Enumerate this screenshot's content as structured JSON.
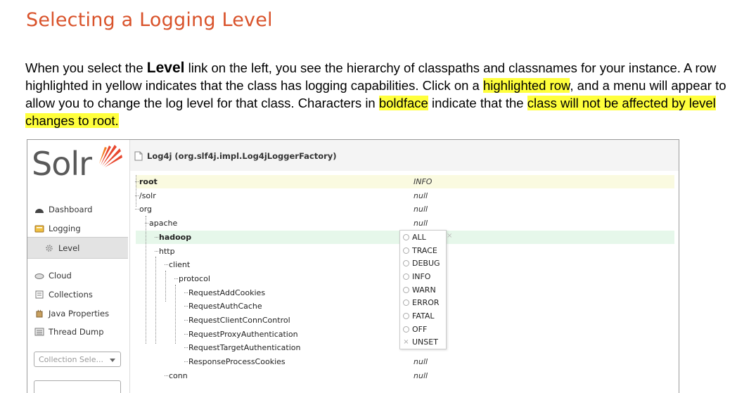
{
  "doc": {
    "title": "Selecting a Logging Level",
    "p1": "When you select the ",
    "level_word": "Level",
    "p2": " link on the left, you see the hierarchy of classpaths and classnames for your instance. A row highlighted in yellow indicates that the class has logging capabilities. Click on a ",
    "hl1": "highlighted row",
    "p3": ", and a menu will appear to allow you to change the log level for that class. Characters in ",
    "hl2": "boldface",
    "p4": " indicate that the ",
    "hl3": "class will not be affected by level changes to root.",
    "highlight_color": "#ffff3c",
    "title_color": "#d9532b"
  },
  "sidebar": {
    "logo": "Solr",
    "items": [
      {
        "label": "Dashboard",
        "icon": "dashboard-icon"
      },
      {
        "label": "Logging",
        "icon": "logging-icon"
      },
      {
        "label": "Level",
        "icon": "gear-icon"
      },
      {
        "label": "Cloud",
        "icon": "cloud-icon"
      },
      {
        "label": "Collections",
        "icon": "collections-icon"
      },
      {
        "label": "Java Properties",
        "icon": "java-icon"
      },
      {
        "label": "Thread Dump",
        "icon": "thread-icon"
      }
    ],
    "collection_select": "Collection Sele..."
  },
  "main": {
    "header": "Log4j (org.slf4j.impl.Log4jLoggerFactory)",
    "rows": [
      {
        "name": "root",
        "level": "INFO",
        "bold": true
      },
      {
        "name": "/solr",
        "level": "null"
      },
      {
        "name": "org",
        "level": "null"
      },
      {
        "name": "apache",
        "level": "null"
      },
      {
        "name": "hadoop",
        "level": "",
        "bold": true
      },
      {
        "name": "http",
        "level": ""
      },
      {
        "name": "client",
        "level": ""
      },
      {
        "name": "protocol",
        "level": ""
      },
      {
        "name": "RequestAddCookies",
        "level": ""
      },
      {
        "name": "RequestAuthCache",
        "level": ""
      },
      {
        "name": "RequestClientConnControl",
        "level": ""
      },
      {
        "name": "RequestProxyAuthentication",
        "level": ""
      },
      {
        "name": "RequestTargetAuthentication",
        "level": ""
      },
      {
        "name": "ResponseProcessCookies",
        "level": "null"
      },
      {
        "name": "conn",
        "level": "null"
      }
    ],
    "menu": [
      "ALL",
      "TRACE",
      "DEBUG",
      "INFO",
      "WARN",
      "ERROR",
      "FATAL",
      "OFF",
      "UNSET"
    ],
    "menu_close": "×"
  }
}
